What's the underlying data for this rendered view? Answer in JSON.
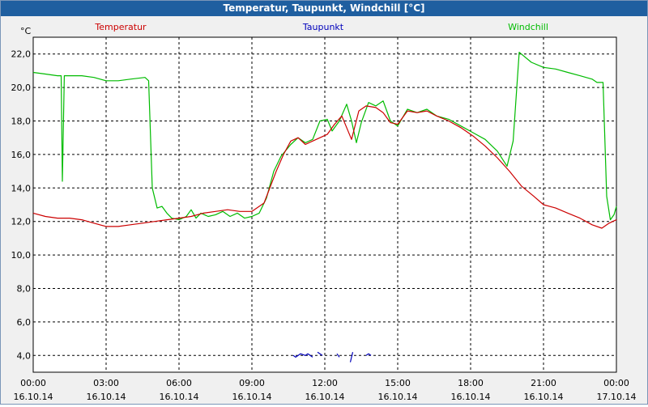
{
  "window": {
    "title": "Temperatur, Taupunkt, Windchill [°C]"
  },
  "chart_data": {
    "type": "line",
    "title": "Temperatur, Taupunkt, Windchill [°C]",
    "ylabel": "°C",
    "ylim": [
      3,
      23
    ],
    "grid": true,
    "xlim_hours": [
      0,
      24
    ],
    "legend_placement": "top",
    "y_ticks": [
      "4,0",
      "6,0",
      "8,0",
      "10,0",
      "12,0",
      "14,0",
      "16,0",
      "18,0",
      "20,0",
      "22,0"
    ],
    "y_tick_values": [
      4,
      6,
      8,
      10,
      12,
      14,
      16,
      18,
      20,
      22
    ],
    "x_ticks": [
      {
        "time": "00:00",
        "date": "16.10.14",
        "h": 0
      },
      {
        "time": "03:00",
        "date": "16.10.14",
        "h": 3
      },
      {
        "time": "06:00",
        "date": "16.10.14",
        "h": 6
      },
      {
        "time": "09:00",
        "date": "16.10.14",
        "h": 9
      },
      {
        "time": "12:00",
        "date": "16.10.14",
        "h": 12
      },
      {
        "time": "15:00",
        "date": "16.10.14",
        "h": 15
      },
      {
        "time": "18:00",
        "date": "16.10.14",
        "h": 18
      },
      {
        "time": "21:00",
        "date": "16.10.14",
        "h": 21
      },
      {
        "time": "00:00",
        "date": "17.10.14",
        "h": 24
      }
    ],
    "series": [
      {
        "name": "Temperatur",
        "color": "#cc0000",
        "points": [
          [
            0,
            12.5
          ],
          [
            0.5,
            12.3
          ],
          [
            1,
            12.2
          ],
          [
            1.5,
            12.2
          ],
          [
            2,
            12.1
          ],
          [
            2.5,
            11.9
          ],
          [
            3,
            11.7
          ],
          [
            3.5,
            11.7
          ],
          [
            4,
            11.8
          ],
          [
            4.5,
            11.9
          ],
          [
            5,
            12.0
          ],
          [
            5.5,
            12.1
          ],
          [
            6,
            12.2
          ],
          [
            6.5,
            12.3
          ],
          [
            7,
            12.5
          ],
          [
            7.5,
            12.6
          ],
          [
            8,
            12.7
          ],
          [
            8.5,
            12.6
          ],
          [
            9,
            12.6
          ],
          [
            9.5,
            13.1
          ],
          [
            10,
            15.0
          ],
          [
            10.3,
            16.0
          ],
          [
            10.6,
            16.8
          ],
          [
            10.9,
            17.0
          ],
          [
            11.2,
            16.6
          ],
          [
            11.5,
            16.8
          ],
          [
            11.8,
            17.0
          ],
          [
            12.1,
            17.2
          ],
          [
            12.4,
            17.8
          ],
          [
            12.7,
            18.3
          ],
          [
            13.1,
            16.9
          ],
          [
            13.4,
            18.6
          ],
          [
            13.7,
            18.9
          ],
          [
            14.1,
            18.8
          ],
          [
            14.4,
            18.5
          ],
          [
            14.7,
            17.9
          ],
          [
            15,
            17.8
          ],
          [
            15.4,
            18.6
          ],
          [
            15.8,
            18.5
          ],
          [
            16.2,
            18.6
          ],
          [
            16.6,
            18.3
          ],
          [
            17.1,
            18.0
          ],
          [
            17.6,
            17.6
          ],
          [
            18.1,
            17.1
          ],
          [
            18.6,
            16.5
          ],
          [
            19.1,
            15.8
          ],
          [
            19.6,
            15.0
          ],
          [
            20.1,
            14.1
          ],
          [
            20.6,
            13.5
          ],
          [
            21,
            13.0
          ],
          [
            21.5,
            12.8
          ],
          [
            22,
            12.5
          ],
          [
            22.5,
            12.2
          ],
          [
            23,
            11.8
          ],
          [
            23.4,
            11.6
          ],
          [
            23.7,
            11.9
          ],
          [
            24,
            12.1
          ]
        ]
      },
      {
        "name": "Taupunkt",
        "color": "#0000bb",
        "segments": [
          [
            [
              10.7,
              4.0
            ],
            [
              10.8,
              3.9
            ],
            [
              11.0,
              4.1
            ],
            [
              11.2,
              4.0
            ],
            [
              11.3,
              4.1
            ],
            [
              11.5,
              3.9
            ]
          ],
          [
            [
              11.7,
              4.2
            ],
            [
              11.9,
              4.0
            ]
          ],
          [
            [
              12.5,
              4.1
            ],
            [
              12.6,
              3.9
            ]
          ],
          [
            [
              13.05,
              3.6
            ],
            [
              13.15,
              4.2
            ]
          ],
          [
            [
              13.7,
              4.0
            ],
            [
              13.8,
              4.1
            ],
            [
              13.9,
              4.0
            ]
          ]
        ]
      },
      {
        "name": "Windchill",
        "color": "#00bb00",
        "points": [
          [
            0,
            20.9
          ],
          [
            0.5,
            20.8
          ],
          [
            1,
            20.7
          ],
          [
            1.15,
            20.7
          ],
          [
            1.2,
            14.4
          ],
          [
            1.28,
            20.7
          ],
          [
            1.5,
            20.7
          ],
          [
            2,
            20.7
          ],
          [
            2.5,
            20.6
          ],
          [
            3,
            20.4
          ],
          [
            3.5,
            20.4
          ],
          [
            4,
            20.5
          ],
          [
            4.6,
            20.6
          ],
          [
            4.75,
            20.4
          ],
          [
            4.9,
            14.0
          ],
          [
            5.1,
            12.8
          ],
          [
            5.3,
            12.9
          ],
          [
            5.5,
            12.5
          ],
          [
            5.7,
            12.2
          ],
          [
            6,
            12.1
          ],
          [
            6.3,
            12.3
          ],
          [
            6.5,
            12.7
          ],
          [
            6.7,
            12.2
          ],
          [
            6.9,
            12.5
          ],
          [
            7.2,
            12.3
          ],
          [
            7.5,
            12.4
          ],
          [
            7.8,
            12.6
          ],
          [
            8.1,
            12.3
          ],
          [
            8.4,
            12.5
          ],
          [
            8.7,
            12.2
          ],
          [
            9,
            12.3
          ],
          [
            9.3,
            12.5
          ],
          [
            9.6,
            13.4
          ],
          [
            9.9,
            15.0
          ],
          [
            10.2,
            15.9
          ],
          [
            10.6,
            16.6
          ],
          [
            10.9,
            17.0
          ],
          [
            11.2,
            16.7
          ],
          [
            11.5,
            16.9
          ],
          [
            11.8,
            18.0
          ],
          [
            12.1,
            18.1
          ],
          [
            12.3,
            17.4
          ],
          [
            12.6,
            18.0
          ],
          [
            12.9,
            19.0
          ],
          [
            13.1,
            18.0
          ],
          [
            13.3,
            16.7
          ],
          [
            13.5,
            17.9
          ],
          [
            13.8,
            19.1
          ],
          [
            14.1,
            18.9
          ],
          [
            14.4,
            19.2
          ],
          [
            14.7,
            18.0
          ],
          [
            15,
            17.7
          ],
          [
            15.4,
            18.7
          ],
          [
            15.8,
            18.5
          ],
          [
            16.2,
            18.7
          ],
          [
            16.6,
            18.3
          ],
          [
            17.1,
            18.1
          ],
          [
            17.6,
            17.7
          ],
          [
            18.1,
            17.3
          ],
          [
            18.6,
            16.9
          ],
          [
            19.1,
            16.2
          ],
          [
            19.5,
            15.3
          ],
          [
            19.75,
            16.8
          ],
          [
            20.0,
            22.1
          ],
          [
            20.5,
            21.5
          ],
          [
            21,
            21.2
          ],
          [
            21.5,
            21.1
          ],
          [
            22,
            20.9
          ],
          [
            22.5,
            20.7
          ],
          [
            23,
            20.5
          ],
          [
            23.2,
            20.3
          ],
          [
            23.45,
            20.3
          ],
          [
            23.6,
            13.5
          ],
          [
            23.75,
            12.1
          ],
          [
            23.9,
            12.4
          ],
          [
            24,
            12.9
          ]
        ]
      }
    ]
  }
}
